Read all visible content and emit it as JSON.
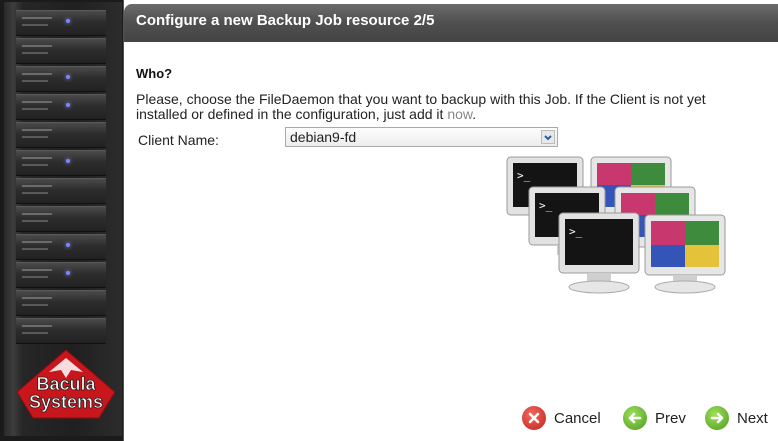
{
  "header": {
    "title": "Configure a new Backup Job resource 2/5"
  },
  "section": {
    "heading": "Who?"
  },
  "description": {
    "text_before": "Please, choose the FileDaemon that you want to backup with this Job. If the Client is not yet installed or defined in the configuration, just add it ",
    "link": "now",
    "text_after": "."
  },
  "client": {
    "label": "Client Name:",
    "selected": "debian9-fd"
  },
  "logo": {
    "line1": "Bacula",
    "line2": "Systems"
  },
  "buttons": {
    "cancel": "Cancel",
    "prev": "Prev",
    "next": "Next"
  },
  "colors": {
    "header_bg": "#4f4f4f",
    "cancel": "#d9322e",
    "nav": "#6cb82e",
    "link": "#888888"
  }
}
